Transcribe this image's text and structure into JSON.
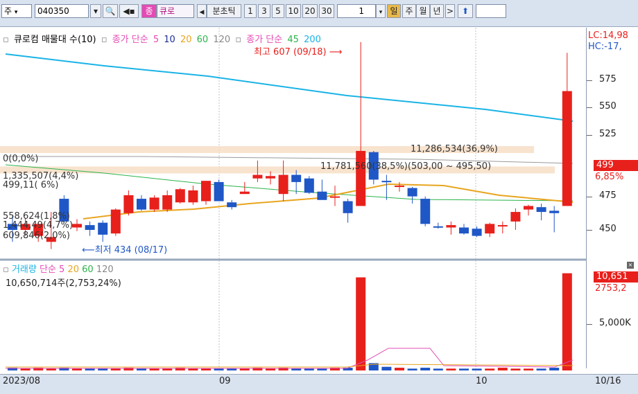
{
  "toolbar": {
    "mode_label": "주",
    "code_value": "040350",
    "jong_label": "종",
    "stock_name": "큐로",
    "period_label": "분초틱",
    "intervals": [
      "1",
      "3",
      "5",
      "10",
      "20",
      "30"
    ],
    "unit_value": "1",
    "day_label": "일",
    "week_label": "주",
    "month_label": "월",
    "year_label": "년"
  },
  "price_legend": {
    "series1": "큐로컴 매물대 수(10)",
    "ma_title": "종가 단순",
    "ma5": "5",
    "ma10": "10",
    "ma20": "20",
    "ma60": "60",
    "ma120": "120",
    "ma2_title": "종가 단순",
    "ma45": "45",
    "ma200": "200"
  },
  "annotations": {
    "high": "최고 607 (09/18)",
    "low": "최저 434 (08/17)",
    "vp_top": "11,286,534(36,9%)",
    "vp_mid": "11,781,560(38,5%)(503,00 ~ 495,50)",
    "zero_pct": "0(0,0%)",
    "vp_l1": "1,335,507(4,4%)",
    "vp_l2": "499,11(  6%)",
    "vp_l3": "558,624(1,8%)",
    "vp_l4": "1,444,49(4,7%)",
    "vp_l5": "609,846(2,0%)",
    "lc": "LC:14,98",
    "hc": "HC:-17,",
    "cur_price": "499",
    "cur_change": "6,85%"
  },
  "price_axis": [
    "575",
    "550",
    "525",
    "475",
    "450"
  ],
  "volume": {
    "legend_title": "거래량",
    "ma_title": "단순",
    "ma5": "5",
    "ma20": "20",
    "ma60": "60",
    "ma120": "120",
    "total": "10,650,714주(2,753,24%)",
    "badge": "10,651",
    "badge_pct": "2753,2",
    "axis_5000": "5,000K"
  },
  "dates": [
    "2023/08",
    "09",
    "10",
    "10/16"
  ],
  "colors": {
    "up": "#e8201c",
    "down": "#1f57c7",
    "ma_cyan": "#19b3e6",
    "ma_orange": "#e8a51e",
    "ma_green": "#2bb34a",
    "ma_pink": "#e44bb4",
    "ma_navy": "#1d2f8f"
  },
  "chart_data": {
    "type": "bar",
    "title": "큐로컴",
    "ylim": [
      430,
      610
    ],
    "candles": [
      {
        "o": 455,
        "h": 462,
        "l": 440,
        "c": 450
      },
      {
        "o": 450,
        "h": 460,
        "l": 445,
        "c": 455
      },
      {
        "o": 445,
        "h": 456,
        "l": 440,
        "c": 455
      },
      {
        "o": 440,
        "h": 465,
        "l": 434,
        "c": 444
      },
      {
        "o": 476,
        "h": 479,
        "l": 456,
        "c": 457
      },
      {
        "o": 452,
        "h": 459,
        "l": 449,
        "c": 455
      },
      {
        "o": 454,
        "h": 457,
        "l": 445,
        "c": 450
      },
      {
        "o": 456,
        "h": 458,
        "l": 440,
        "c": 446
      },
      {
        "o": 447,
        "h": 468,
        "l": 445,
        "c": 467
      },
      {
        "o": 464,
        "h": 483,
        "l": 462,
        "c": 479
      },
      {
        "o": 476,
        "h": 479,
        "l": 466,
        "c": 467
      },
      {
        "o": 467,
        "h": 479,
        "l": 465,
        "c": 477
      },
      {
        "o": 467,
        "h": 483,
        "l": 465,
        "c": 479
      },
      {
        "o": 473,
        "h": 485,
        "l": 472,
        "c": 484
      },
      {
        "o": 473,
        "h": 487,
        "l": 471,
        "c": 483
      },
      {
        "o": 474,
        "h": 488,
        "l": 471,
        "c": 491
      },
      {
        "o": 490,
        "h": 492,
        "l": 476,
        "c": 474
      },
      {
        "o": 473,
        "h": 475,
        "l": 467,
        "c": 469
      },
      {
        "o": 480,
        "h": 490,
        "l": 480,
        "c": 482
      },
      {
        "o": 493,
        "h": 508,
        "l": 490,
        "c": 496
      },
      {
        "o": 493,
        "h": 499,
        "l": 488,
        "c": 495
      },
      {
        "o": 480,
        "h": 508,
        "l": 474,
        "c": 496
      },
      {
        "o": 496,
        "h": 500,
        "l": 480,
        "c": 490
      },
      {
        "o": 493,
        "h": 495,
        "l": 480,
        "c": 481
      },
      {
        "o": 482,
        "h": 492,
        "l": 476,
        "c": 475
      },
      {
        "o": 478,
        "h": 487,
        "l": 470,
        "c": 478
      },
      {
        "o": 474,
        "h": 476,
        "l": 456,
        "c": 464
      },
      {
        "o": 470,
        "h": 607,
        "l": 470,
        "c": 516
      },
      {
        "o": 515,
        "h": 516,
        "l": 488,
        "c": 492
      },
      {
        "o": 491,
        "h": 496,
        "l": 475,
        "c": 490
      },
      {
        "o": 486,
        "h": 490,
        "l": 482,
        "c": 487
      },
      {
        "o": 485,
        "h": 486,
        "l": 472,
        "c": 478
      },
      {
        "o": 476,
        "h": 478,
        "l": 453,
        "c": 455
      },
      {
        "o": 453,
        "h": 456,
        "l": 451,
        "c": 452
      },
      {
        "o": 452,
        "h": 457,
        "l": 446,
        "c": 454
      },
      {
        "o": 452,
        "h": 455,
        "l": 446,
        "c": 447
      },
      {
        "o": 451,
        "h": 453,
        "l": 444,
        "c": 445
      },
      {
        "o": 447,
        "h": 456,
        "l": 444,
        "c": 455
      },
      {
        "o": 453,
        "h": 457,
        "l": 447,
        "c": 454
      },
      {
        "o": 457,
        "h": 468,
        "l": 450,
        "c": 465
      },
      {
        "o": 467,
        "h": 471,
        "l": 462,
        "c": 470
      },
      {
        "o": 469,
        "h": 472,
        "l": 458,
        "c": 465
      },
      {
        "o": 466,
        "h": 470,
        "l": 448,
        "c": 464
      },
      {
        "o": 470,
        "h": 598,
        "l": 470,
        "c": 566
      }
    ],
    "volumes": [
      0.3,
      0.2,
      0.3,
      0.2,
      0.3,
      0.2,
      0.2,
      0.2,
      0.2,
      0.3,
      0.2,
      0.2,
      0.2,
      0.3,
      0.2,
      0.2,
      0.2,
      0.2,
      0.2,
      0.3,
      0.2,
      0.3,
      0.2,
      0.2,
      0.2,
      0.3,
      0.3,
      10.2,
      0.8,
      0.4,
      0.3,
      0.2,
      0.3,
      0.2,
      0.2,
      0.2,
      0.2,
      0.2,
      0.3,
      0.2,
      0.2,
      0.2,
      0.3,
      10.65
    ]
  }
}
